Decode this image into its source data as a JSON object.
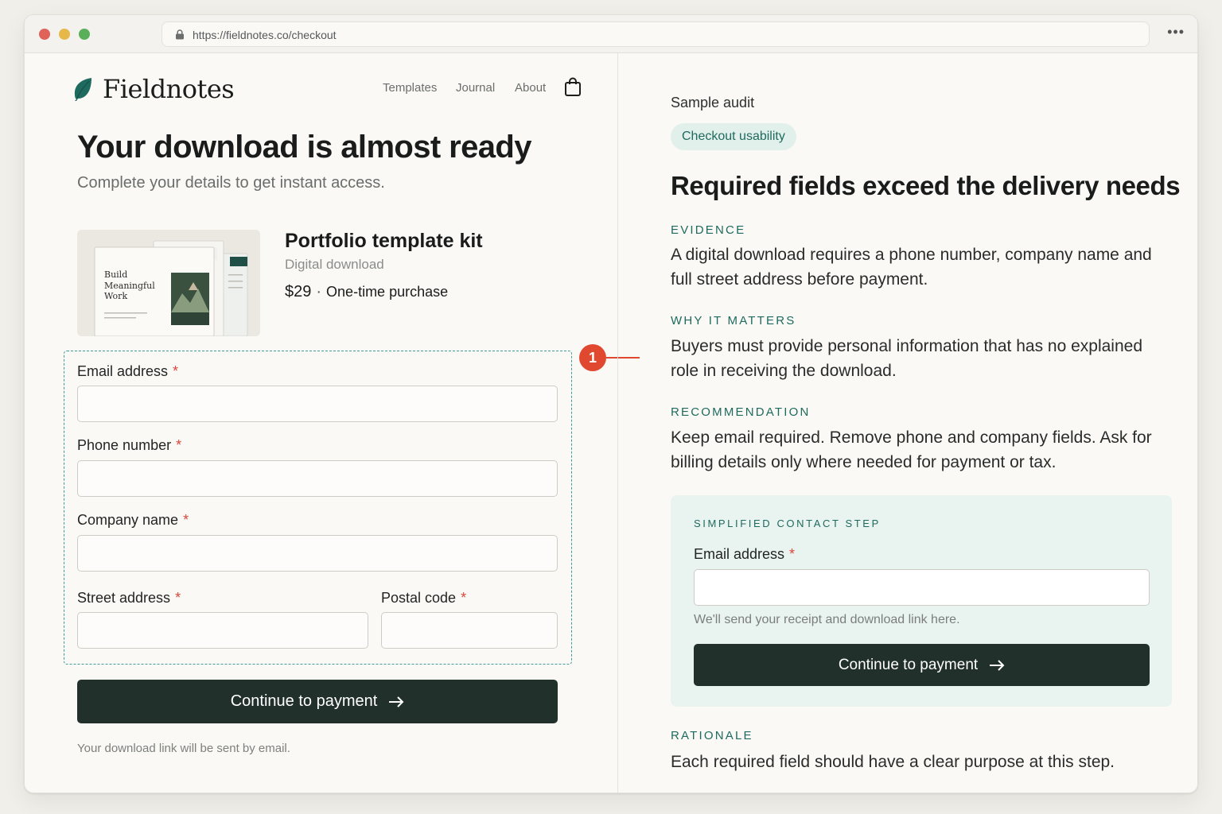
{
  "browser": {
    "url": "https://fieldnotes.co/checkout",
    "more_label": "•••"
  },
  "site": {
    "brand": "Fieldnotes",
    "brand_color": "#1f6a5e",
    "nav": [
      "Templates",
      "Journal",
      "About"
    ],
    "cart_icon": "shopping-bag-icon"
  },
  "checkout": {
    "headline": "Your download is almost ready",
    "subheadline": "Complete your details to get instant access.",
    "product": {
      "title": "Portfolio template kit",
      "type": "Digital download",
      "price": "$29",
      "separator": "·",
      "price_note": "One-time purchase",
      "thumb_text": "Build Meaningful Work"
    },
    "fields": {
      "email": {
        "label": "Email address",
        "required": "*",
        "value": ""
      },
      "phone": {
        "label": "Phone number",
        "required": "*",
        "value": ""
      },
      "company": {
        "label": "Company name",
        "required": "*",
        "value": ""
      },
      "street": {
        "label": "Street address",
        "required": "*",
        "value": ""
      },
      "postal": {
        "label": "Postal code",
        "required": "*",
        "value": ""
      }
    },
    "annotation_number": "1",
    "cta_label": "Continue to payment",
    "footnote": "Your download link will be sent by email."
  },
  "audit": {
    "label": "Sample audit",
    "tag": "Checkout usability",
    "title": "Required fields exceed the delivery needs",
    "evidence_label": "EVIDENCE",
    "evidence_text": "A digital download requires a phone number, company name and full street address before payment.",
    "why_label": "WHY IT MATTERS",
    "why_text": "Buyers must provide personal information that has no explained role in receiving the download.",
    "recommendation_label": "RECOMMENDATION",
    "recommendation_text": "Keep email required. Remove phone and company fields. Ask for billing details only where needed for payment or tax.",
    "simplified": {
      "label": "SIMPLIFIED CONTACT STEP",
      "field_label": "Email address",
      "required": "*",
      "value": "",
      "help": "We'll send your receipt and download link here.",
      "cta_label": "Continue to payment"
    },
    "rationale_label": "RATIONALE",
    "rationale_text": "Each required field should have a clear purpose at this step."
  },
  "colors": {
    "accent": "#1f6a5e",
    "cta": "#22302c",
    "required": "#d9473a",
    "annotation": "#e0492f",
    "highlight_border": "#3d9a97"
  }
}
